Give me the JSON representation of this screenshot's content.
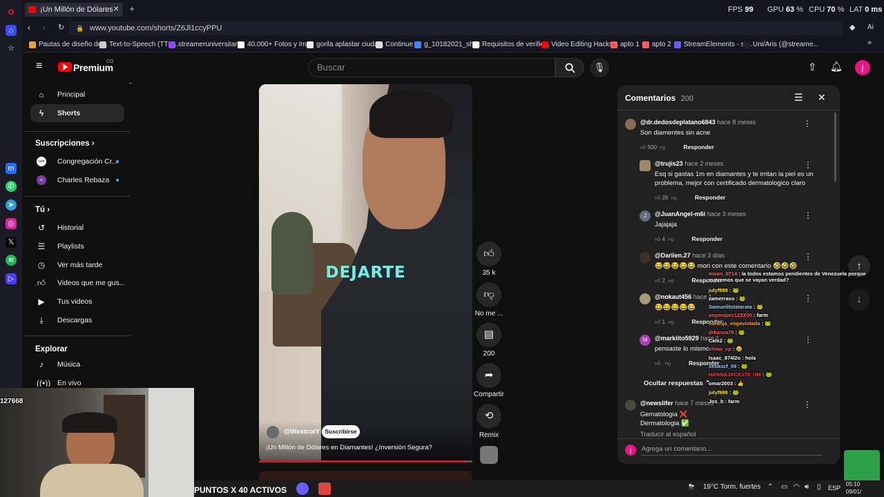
{
  "browser": {
    "tab_title": "¡Un Millón de Dólares",
    "url": "www.youtube.com/shorts/Z6Jl1ccyPPU",
    "stats": {
      "fps_label": "FPS",
      "fps_value": "99",
      "gpu_label": "GPU",
      "gpu_value": "63",
      "cpu_label": "CPU",
      "cpu_value": "70",
      "lat_label": "LAT",
      "lat_value": "0 ms"
    },
    "bookmarks": [
      {
        "label": "Pautas de diseño de...",
        "color": "#e8a33d"
      },
      {
        "label": "Text-to-Speech (TTS...",
        "color": "#cccccc"
      },
      {
        "label": "streameruniversitari...",
        "color": "#9146ff"
      },
      {
        "label": "40.000+ Fotos y Im...",
        "color": "#ffffff"
      },
      {
        "label": "gorila aplastar ciuda...",
        "color": "#eeeeee"
      },
      {
        "label": "Continue",
        "color": "#dddddd"
      },
      {
        "label": "g_10182021_shcc",
        "color": "#4285f4"
      },
      {
        "label": "Requisitos de verific...",
        "color": "#ffffff"
      },
      {
        "label": "Video Editing Hacks...",
        "color": "#ff0000"
      },
      {
        "label": "apto 1",
        "color": "#ff5a5f"
      },
      {
        "label": "apto 2",
        "color": "#ff5a5f"
      },
      {
        "label": "StreamElements - st...",
        "color": "#6b5cff"
      },
      {
        "label": "Uni/Aris (@streame...",
        "color": "#222222"
      }
    ]
  },
  "youtube": {
    "brand": "Premium",
    "brand_country": "CO",
    "search_placeholder": "Buscar",
    "avatar_letter": "j",
    "sidebar": {
      "items_top": [
        {
          "label": "Principal",
          "icon": "home-icon"
        },
        {
          "label": "Shorts",
          "icon": "shorts-icon"
        }
      ],
      "subscriptions_heading": "Suscripciones",
      "subscriptions": [
        {
          "label": "Congregación Cr...",
          "badge": "ccm"
        },
        {
          "label": "Charles Rebaza",
          "badge": "cr"
        }
      ],
      "you_heading": "Tú",
      "you_items": [
        {
          "label": "Historial",
          "icon": "history-icon"
        },
        {
          "label": "Playlists",
          "icon": "playlist-icon"
        },
        {
          "label": "Ver más tarde",
          "icon": "clock-icon"
        },
        {
          "label": "Videos que me gus...",
          "icon": "like-icon"
        },
        {
          "label": "Tus videos",
          "icon": "video-icon"
        },
        {
          "label": "Descargas",
          "icon": "download-icon"
        }
      ],
      "explore_heading": "Explorar",
      "explore_items": [
        {
          "label": "Música",
          "icon": "music-icon"
        },
        {
          "label": "En vivo",
          "icon": "live-icon"
        }
      ]
    },
    "short": {
      "caption": "DEJARTE",
      "channel": "@WestcolY",
      "subscribe": "Suscribirse",
      "title": "¡Un Millón de Dólares en Diamantes! ¿Inversión Segura?",
      "actions": {
        "like_count": "35 k",
        "dislike_label": "No me ...",
        "comment_count": "200",
        "share_label": "Compartir",
        "remix_label": "Remix"
      }
    },
    "comments": {
      "title": "Comentarios",
      "count": "200",
      "reply_label": "Responder",
      "hide_replies": "Ocultar respuestas",
      "translate": "Traducir al español",
      "add_placeholder": "Agrega un comentario...",
      "items": [
        {
          "author": "@dr.dedosdeplatano6843",
          "time": "hace 8 meses",
          "text": "Son diamentes sin acne",
          "likes": "500",
          "color": "#8a6b5a"
        },
        {
          "author": "@trujis23",
          "time": "hace 2 meses",
          "text": "Esq si gastas 1m en diamantes y te irritan la piel es un problema, mejor con certificado dermatologico claro",
          "likes": "26",
          "color": "#9b8a6a"
        },
        {
          "author": "@JuanAngel-m6i",
          "time": "hace 3 meses",
          "text": "Jajajaja",
          "likes": "4",
          "color": "#5f6f80",
          "letter": "J"
        },
        {
          "author": "@Dariien.27",
          "time": "hace 3 días",
          "text": "😂😂😂😂😂 mori con este comentario 🤣🤣🤣",
          "likes": "2",
          "color": "#3c3025"
        },
        {
          "author": "@nokaut456",
          "time": "hace 1",
          "text": "😂😂😂😂😂",
          "likes": "1",
          "color": "#a89b7a"
        },
        {
          "author": "@markiito5929",
          "time": "hace 1",
          "text": "pensaste lo mismo",
          "likes": "",
          "color": "#a43fb4",
          "letter": "M"
        },
        {
          "author": "@newslifer",
          "time": "hace 7 meses",
          "text": "Gematologia ❌",
          "text2": "Dermatologia ✅",
          "likes": "",
          "color": "#4a4a3a"
        }
      ]
    }
  },
  "chat_overlay": {
    "messages": [
      {
        "user": "moon_0714",
        "text": "la todos estamos pendientes de Venezuela porque queremos que se vayan verdad?",
        "color": "#ff6a6a"
      },
      {
        "user": "julyf999",
        "text": "🐸",
        "color": "#ffe04a"
      },
      {
        "user": "zamerraso",
        "text": "🐸",
        "color": "#ffffff"
      },
      {
        "user": "Samuelitotatarata",
        "text": "🐸",
        "color": "#9ad0ff"
      },
      {
        "user": "pepenipes123X00",
        "text": "farm",
        "color": "#ff5a5a"
      },
      {
        "user": "naranja_engaviotada",
        "text": "🐸",
        "color": "#ffa03a"
      },
      {
        "user": "drkanza78",
        "text": "🐸",
        "color": "#ff5a5a"
      },
      {
        "user": "Cals2",
        "text": "🐸",
        "color": "#ffffff"
      },
      {
        "user": "chino_vp",
        "text": "😂",
        "color": "#ff5a5a"
      },
      {
        "user": "Isaac_874l2o",
        "text": "hola",
        "color": "#ffffff"
      },
      {
        "user": "sebascf_09",
        "text": "🐸",
        "color": "#9ad0ff"
      },
      {
        "user": "HANNAJACK178_UM",
        "text": "🐸",
        "color": "#ff3a3a"
      },
      {
        "user": "omar2003",
        "text": "👍",
        "color": "#ffffff"
      },
      {
        "user": "julyf999",
        "text": "🐸",
        "color": "#ffe04a"
      },
      {
        "user": "Jos_b",
        "text": "farm",
        "color": "#ffffff"
      }
    ]
  },
  "webcam": {
    "counter": "127668"
  },
  "taskbar": {
    "points_text": "PUNTOS X 40 ACTIVOS",
    "temperature": "19°C",
    "weather": "Torm. fuertes",
    "language": "ESP",
    "time": "05:10",
    "date": "09/01/"
  }
}
